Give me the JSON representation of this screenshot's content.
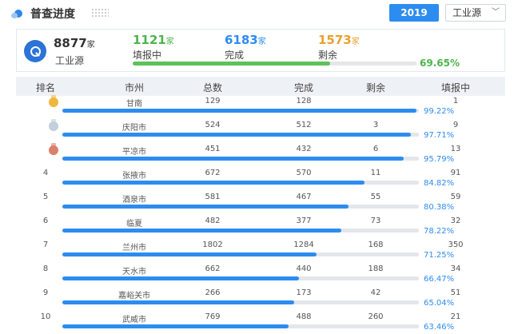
{
  "header": {
    "title": "普查进度",
    "year": "2019",
    "source_selected": "工业源"
  },
  "summary": {
    "total": "8877",
    "total_unit": "家",
    "total_label": "工业源",
    "filling": {
      "value": "1121",
      "unit": "家",
      "label": "填报中"
    },
    "completed": {
      "value": "6183",
      "unit": "家",
      "label": "完成"
    },
    "remaining": {
      "value": "1573",
      "unit": "家",
      "label": "剩余"
    },
    "progress_pct": "69.65%",
    "progress_fraction": 0.6965
  },
  "colors": {
    "accent": "#2d8cf0",
    "green": "#4bb54b",
    "orange": "#e9a12f"
  },
  "table": {
    "headers": [
      "排名",
      "市州",
      "总数",
      "完成",
      "剩余",
      "填报中"
    ],
    "rows": [
      {
        "rank": "",
        "medal": "gold",
        "city": "甘南",
        "total": "129",
        "done": "128",
        "left": "",
        "filling": "1",
        "pct": "99.22%",
        "fraction": 0.9922
      },
      {
        "rank": "",
        "medal": "silver",
        "city": "庆阳市",
        "total": "524",
        "done": "512",
        "left": "3",
        "filling": "9",
        "pct": "97.71%",
        "fraction": 0.9771
      },
      {
        "rank": "",
        "medal": "bronze",
        "city": "平凉市",
        "total": "451",
        "done": "432",
        "left": "6",
        "filling": "13",
        "pct": "95.79%",
        "fraction": 0.9579
      },
      {
        "rank": "4",
        "medal": "",
        "city": "张掖市",
        "total": "672",
        "done": "570",
        "left": "11",
        "filling": "91",
        "pct": "84.82%",
        "fraction": 0.8482
      },
      {
        "rank": "5",
        "medal": "",
        "city": "酒泉市",
        "total": "581",
        "done": "467",
        "left": "55",
        "filling": "59",
        "pct": "80.38%",
        "fraction": 0.8038
      },
      {
        "rank": "6",
        "medal": "",
        "city": "临夏",
        "total": "482",
        "done": "377",
        "left": "73",
        "filling": "32",
        "pct": "78.22%",
        "fraction": 0.7822
      },
      {
        "rank": "7",
        "medal": "",
        "city": "兰州市",
        "total": "1802",
        "done": "1284",
        "left": "168",
        "filling": "350",
        "pct": "71.25%",
        "fraction": 0.7125
      },
      {
        "rank": "8",
        "medal": "",
        "city": "天水市",
        "total": "662",
        "done": "440",
        "left": "188",
        "filling": "34",
        "pct": "66.47%",
        "fraction": 0.6647
      },
      {
        "rank": "9",
        "medal": "",
        "city": "嘉峪关市",
        "total": "266",
        "done": "173",
        "left": "42",
        "filling": "51",
        "pct": "65.04%",
        "fraction": 0.6504
      },
      {
        "rank": "10",
        "medal": "",
        "city": "武威市",
        "total": "769",
        "done": "488",
        "left": "260",
        "filling": "21",
        "pct": "63.46%",
        "fraction": 0.6346
      }
    ]
  }
}
